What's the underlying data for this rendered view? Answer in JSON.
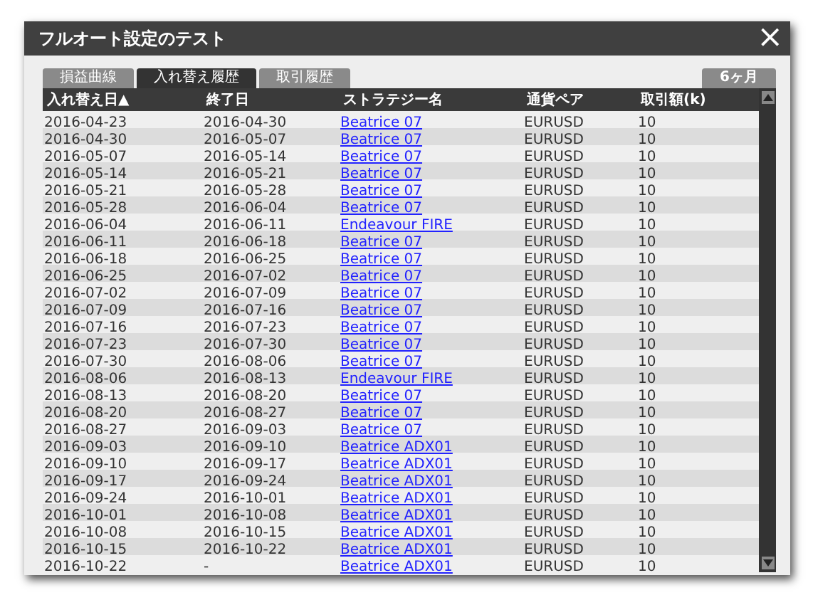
{
  "window": {
    "title": "フルオート設定のテスト",
    "close": "×"
  },
  "tabs": [
    {
      "label": "損益曲線",
      "selected": false
    },
    {
      "label": "入れ替え履歴",
      "selected": true
    },
    {
      "label": "取引履歴",
      "selected": false
    }
  ],
  "period_button": "6ヶ月",
  "table": {
    "columns": [
      "入れ替え日▲",
      "終了日",
      "ストラテジー名",
      "通貨ペア",
      "取引額(k)"
    ],
    "rows": [
      [
        "2016-04-23",
        "2016-04-30",
        "Beatrice 07",
        "EURUSD",
        "10"
      ],
      [
        "2016-04-30",
        "2016-05-07",
        "Beatrice 07",
        "EURUSD",
        "10"
      ],
      [
        "2016-05-07",
        "2016-05-14",
        "Beatrice 07",
        "EURUSD",
        "10"
      ],
      [
        "2016-05-14",
        "2016-05-21",
        "Beatrice 07",
        "EURUSD",
        "10"
      ],
      [
        "2016-05-21",
        "2016-05-28",
        "Beatrice 07",
        "EURUSD",
        "10"
      ],
      [
        "2016-05-28",
        "2016-06-04",
        "Beatrice 07",
        "EURUSD",
        "10"
      ],
      [
        "2016-06-04",
        "2016-06-11",
        "Endeavour FIRE",
        "EURUSD",
        "10"
      ],
      [
        "2016-06-11",
        "2016-06-18",
        "Beatrice 07",
        "EURUSD",
        "10"
      ],
      [
        "2016-06-18",
        "2016-06-25",
        "Beatrice 07",
        "EURUSD",
        "10"
      ],
      [
        "2016-06-25",
        "2016-07-02",
        "Beatrice 07",
        "EURUSD",
        "10"
      ],
      [
        "2016-07-02",
        "2016-07-09",
        "Beatrice 07",
        "EURUSD",
        "10"
      ],
      [
        "2016-07-09",
        "2016-07-16",
        "Beatrice 07",
        "EURUSD",
        "10"
      ],
      [
        "2016-07-16",
        "2016-07-23",
        "Beatrice 07",
        "EURUSD",
        "10"
      ],
      [
        "2016-07-23",
        "2016-07-30",
        "Beatrice 07",
        "EURUSD",
        "10"
      ],
      [
        "2016-07-30",
        "2016-08-06",
        "Beatrice 07",
        "EURUSD",
        "10"
      ],
      [
        "2016-08-06",
        "2016-08-13",
        "Endeavour FIRE",
        "EURUSD",
        "10"
      ],
      [
        "2016-08-13",
        "2016-08-20",
        "Beatrice 07",
        "EURUSD",
        "10"
      ],
      [
        "2016-08-20",
        "2016-08-27",
        "Beatrice 07",
        "EURUSD",
        "10"
      ],
      [
        "2016-08-27",
        "2016-09-03",
        "Beatrice 07",
        "EURUSD",
        "10"
      ],
      [
        "2016-09-03",
        "2016-09-10",
        "Beatrice ADX01",
        "EURUSD",
        "10"
      ],
      [
        "2016-09-10",
        "2016-09-17",
        "Beatrice ADX01",
        "EURUSD",
        "10"
      ],
      [
        "2016-09-17",
        "2016-09-24",
        "Beatrice ADX01",
        "EURUSD",
        "10"
      ],
      [
        "2016-09-24",
        "2016-10-01",
        "Beatrice ADX01",
        "EURUSD",
        "10"
      ],
      [
        "2016-10-01",
        "2016-10-08",
        "Beatrice ADX01",
        "EURUSD",
        "10"
      ],
      [
        "2016-10-08",
        "2016-10-15",
        "Beatrice ADX01",
        "EURUSD",
        "10"
      ],
      [
        "2016-10-15",
        "2016-10-22",
        "Beatrice ADX01",
        "EURUSD",
        "10"
      ],
      [
        "2016-10-22",
        "-",
        "Beatrice ADX01",
        "EURUSD",
        "10"
      ]
    ]
  }
}
